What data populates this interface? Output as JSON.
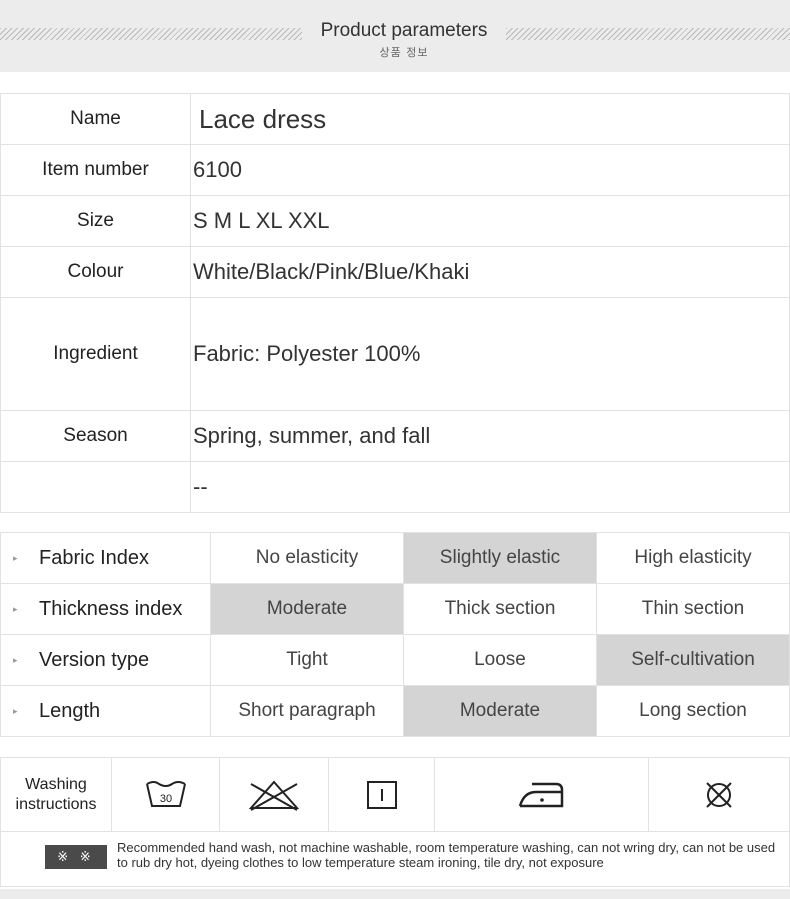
{
  "header": {
    "title": "Product parameters",
    "subtitle": "상품 정보"
  },
  "params": [
    {
      "label": "Name",
      "value": "Lace dress"
    },
    {
      "label": "Item number",
      "value": "6100"
    },
    {
      "label": "Size",
      "value": "S M L XL XXL"
    },
    {
      "label": "Colour",
      "value": "White/Black/Pink/Blue/Khaki"
    },
    {
      "label": "Ingredient",
      "value": "Fabric: Polyester 100%"
    },
    {
      "label": "Season",
      "value": "Spring, summer, and fall"
    },
    {
      "label": "",
      "value": "--"
    }
  ],
  "index": [
    {
      "label": "Fabric Index",
      "options": [
        "No elasticity",
        "Slightly elastic",
        "High elasticity"
      ],
      "selected": 1
    },
    {
      "label": "Thickness index",
      "options": [
        "Moderate",
        "Thick section",
        "Thin section"
      ],
      "selected": 0
    },
    {
      "label": "Version type",
      "options": [
        "Tight",
        "Loose",
        "Self-cultivation"
      ],
      "selected": 2
    },
    {
      "label": "Length",
      "options": [
        "Short paragraph",
        "Moderate",
        "Long section"
      ],
      "selected": 1
    }
  ],
  "care": {
    "label_line1": "Washing",
    "label_line2": "instructions",
    "wash_temp": "30",
    "icons": [
      "wash-30-icon",
      "do-not-bleach-icon",
      "tumble-dry-line-icon",
      "iron-low-icon",
      "do-not-dryclean-icon"
    ],
    "badge": "※ ※",
    "note": "Recommended hand wash, not machine washable, room temperature washing, can not wring dry, can not be used to rub dry hot, dyeing clothes to low temperature steam ironing, tile dry, not exposure"
  }
}
